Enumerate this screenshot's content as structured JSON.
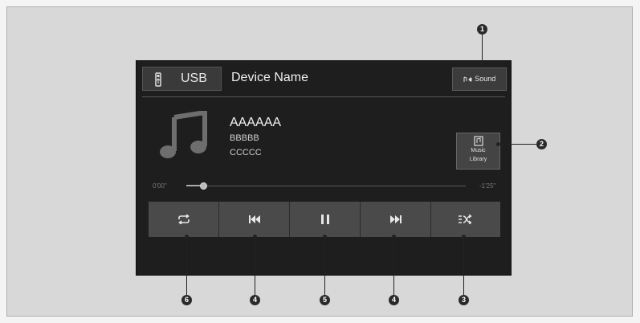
{
  "header": {
    "source_label": "USB",
    "device_name": "Device Name",
    "sound_label": "Sound",
    "sound_icon": "sound-settings-icon"
  },
  "track": {
    "title": "AAAAAA",
    "artist": "BBBBB",
    "album": "CCCCC",
    "art_icon": "music-note-icon"
  },
  "library": {
    "label_line1": "Music",
    "label_line2": "Library",
    "icon": "music-library-icon"
  },
  "progress": {
    "elapsed": "0'00\"",
    "remaining": "-1'25\"",
    "fraction": 0.06
  },
  "controls": [
    {
      "name": "repeat-button",
      "icon": "repeat-icon"
    },
    {
      "name": "previous-track-button",
      "icon": "skip-back-icon"
    },
    {
      "name": "pause-button",
      "icon": "pause-icon"
    },
    {
      "name": "next-track-button",
      "icon": "skip-forward-icon"
    },
    {
      "name": "shuffle-button",
      "icon": "shuffle-icon"
    }
  ],
  "callouts": [
    "1",
    "2",
    "3",
    "4",
    "4",
    "5",
    "6"
  ],
  "colors": {
    "screen_bg": "#1e1e1e",
    "button_bg": "#4a4a4a",
    "text": "#f0f0f0"
  }
}
